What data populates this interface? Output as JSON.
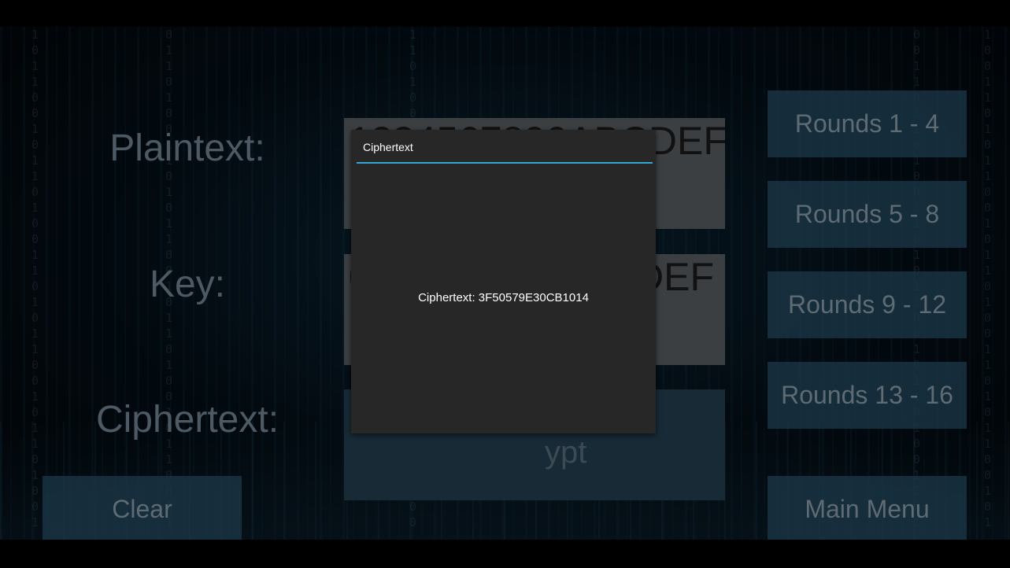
{
  "form": {
    "plaintext_label": "Plaintext:",
    "key_label": "Key:",
    "ciphertext_label": "Ciphertext:",
    "plaintext_value": "1234567890ABCDEF",
    "key_value_left": "0",
    "key_value_right": "DEF",
    "ciphertext_button_partial": "ypt"
  },
  "buttons": {
    "rounds_1_4": "Rounds 1 - 4",
    "rounds_5_8": "Rounds 5 - 8",
    "rounds_9_12": "Rounds 9 - 12",
    "rounds_13_16": "Rounds 13 - 16",
    "clear": "Clear",
    "main_menu": "Main Menu"
  },
  "dialog": {
    "title": "Ciphertext",
    "message": "Ciphertext: 3F50579E30CB1014"
  },
  "colors": {
    "dialog_bg": "#272727",
    "accent": "#35a7d6",
    "background": "#061622"
  }
}
